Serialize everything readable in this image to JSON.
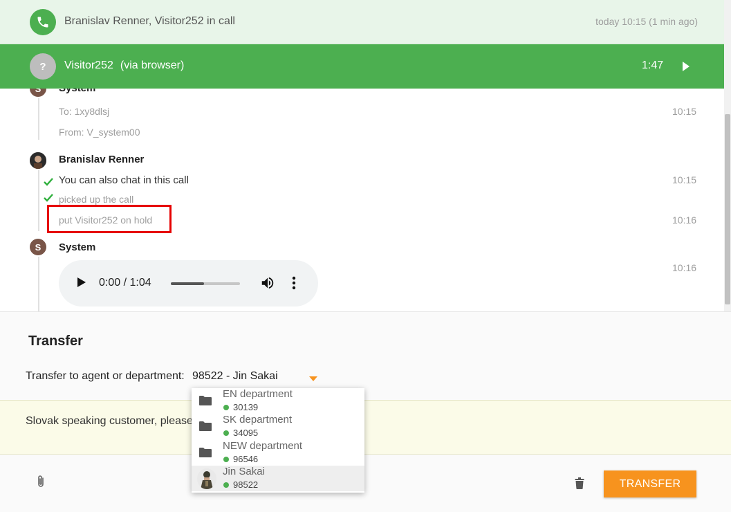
{
  "call_header": {
    "title": "Branislav Renner, Visitor252 in call",
    "time": "today 10:15 (1 min ago)",
    "icon": "phone-icon"
  },
  "visitor_bar": {
    "avatar_letter": "?",
    "name": "Visitor252",
    "via": "(via browser)",
    "duration": "1:47"
  },
  "chat": {
    "system_block": {
      "sender": "System",
      "avatar_letter": "S",
      "messages": [
        {
          "text": "To: 1xy8dlsj",
          "time": "10:15"
        },
        {
          "text": "From: V_system00",
          "time": ""
        }
      ]
    },
    "agent_block": {
      "sender": "Branislav Renner",
      "messages": [
        {
          "text": "You can also chat in this call",
          "time": "10:15"
        },
        {
          "text": "picked up the call",
          "time": ""
        },
        {
          "text": "put Visitor252 on hold",
          "time": "10:16"
        }
      ]
    },
    "system_block_2": {
      "sender": "System",
      "avatar_letter": "S",
      "time": "10:16",
      "audio": {
        "current": "0:00",
        "total": "1:04",
        "separator": "/",
        "progress": 0.48
      }
    }
  },
  "transfer": {
    "heading": "Transfer",
    "label": "Transfer to agent or department:",
    "selected": "98522 - Jin Sakai",
    "options": [
      {
        "name": "EN department",
        "number": "30139",
        "icon": "folder-icon",
        "status": "online"
      },
      {
        "name": "SK department",
        "number": "34095",
        "icon": "folder-icon",
        "status": "online"
      },
      {
        "name": "NEW department",
        "number": "96546",
        "icon": "folder-icon",
        "status": "online"
      },
      {
        "name": "Jin Sakai",
        "number": "98522",
        "icon": "agent-avatar",
        "status": "online"
      }
    ]
  },
  "note": {
    "text": "Slovak speaking customer, please"
  },
  "footer": {
    "transfer_button": "TRANSFER",
    "attach_icon": "paperclip-icon",
    "delete_icon": "trash-icon"
  },
  "colors": {
    "call_green": "#4caf50",
    "header_bg": "#e8f5e9",
    "accent_orange": "#f7931e",
    "highlight_red": "#e60000",
    "note_bg": "#fbfbe8"
  }
}
